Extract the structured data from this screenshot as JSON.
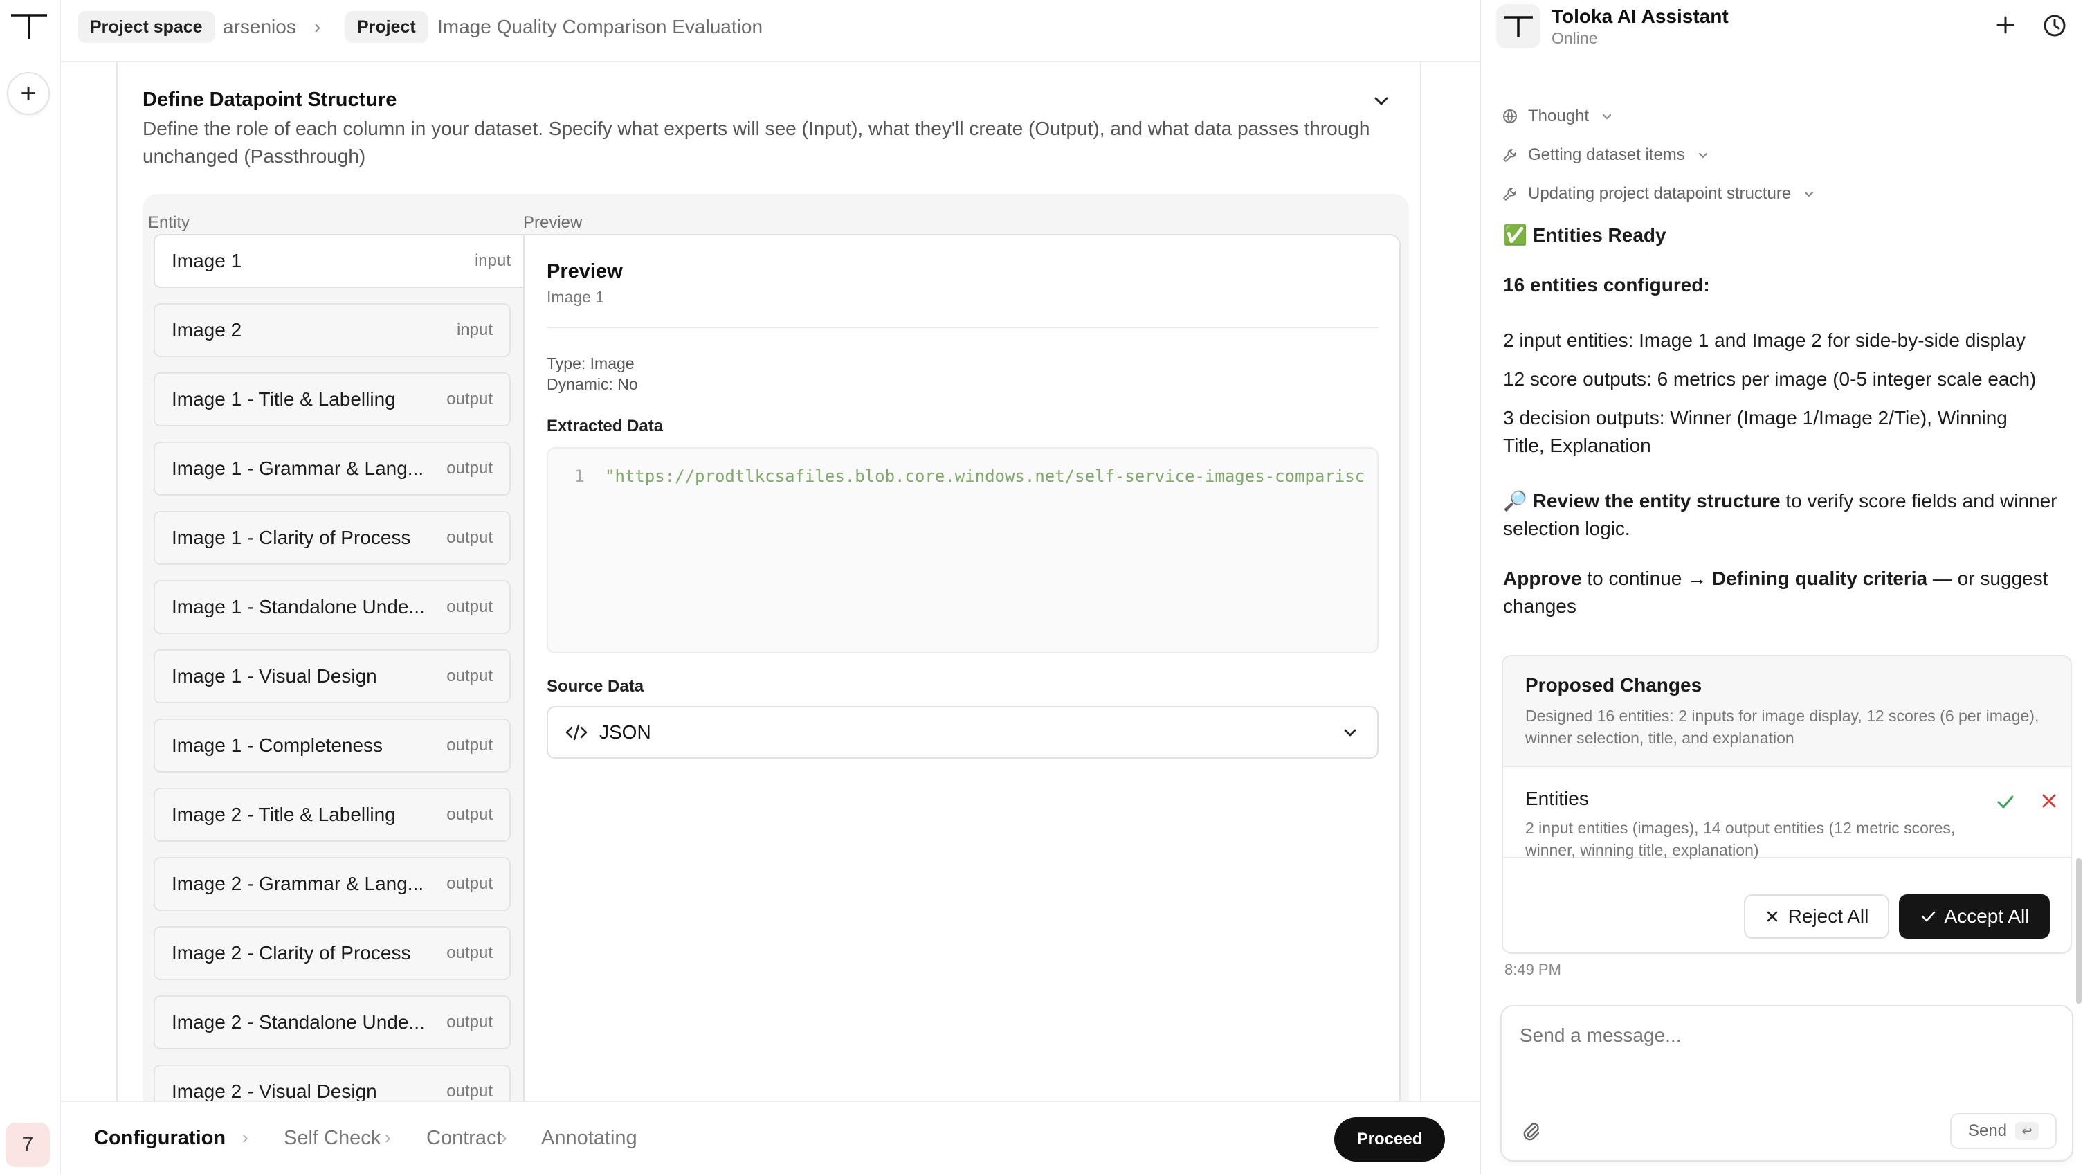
{
  "breadcrumb": {
    "space_chip": "Project space",
    "space_name": "arsenios",
    "separator": "›",
    "project_chip": "Project",
    "project_name": "Image Quality Comparison Evaluation"
  },
  "rail": {
    "user_initial": "7"
  },
  "section": {
    "title": "Define Datapoint Structure",
    "description": "Define the role of each column in your dataset. Specify what experts will see (Input), what they'll create (Output), and what data passes through unchanged (Passthrough)"
  },
  "table": {
    "col_entity": "Entity",
    "col_preview": "Preview",
    "entities": [
      {
        "name": "Image 1",
        "role": "input"
      },
      {
        "name": "Image 2",
        "role": "input"
      },
      {
        "name": "Image 1 - Title & Labelling",
        "role": "output"
      },
      {
        "name": "Image 1 - Grammar & Lang...",
        "role": "output"
      },
      {
        "name": "Image 1 - Clarity of Process",
        "role": "output"
      },
      {
        "name": "Image 1 - Standalone Unde...",
        "role": "output"
      },
      {
        "name": "Image 1 - Visual Design",
        "role": "output"
      },
      {
        "name": "Image 1 - Completeness",
        "role": "output"
      },
      {
        "name": "Image 2 - Title & Labelling",
        "role": "output"
      },
      {
        "name": "Image 2 - Grammar & Lang...",
        "role": "output"
      },
      {
        "name": "Image 2 - Clarity of Process",
        "role": "output"
      },
      {
        "name": "Image 2 - Standalone Unde...",
        "role": "output"
      },
      {
        "name": "Image 2 - Visual Design",
        "role": "output"
      }
    ]
  },
  "preview": {
    "title": "Preview",
    "subtitle": "Image 1",
    "type_label": "Type:",
    "type_value": "Image",
    "dynamic_label": "Dynamic:",
    "dynamic_value": "No",
    "extracted_label": "Extracted Data",
    "code_line_no": "1",
    "code_text": "\"https://prodtlkcsafiles.blob.core.windows.net/self-service-images-comparisc",
    "source_label": "Source Data",
    "source_value": "JSON"
  },
  "steps": {
    "items": [
      "Configuration",
      "Self Check",
      "Contract",
      "Annotating"
    ],
    "separator": "›",
    "proceed": "Proceed"
  },
  "assistant": {
    "name": "Toloka AI Assistant",
    "status": "Online",
    "tools": [
      "Thought",
      "Getting dataset items",
      "Updating project datapoint structure"
    ],
    "ready": "✅ Entities Ready",
    "count_line": "16 entities configured:",
    "lines": [
      "2 input entities: Image 1 and Image 2 for side-by-side display",
      "12 score outputs: 6 metrics per image (0-5 integer scale each)",
      "3 decision outputs: Winner (Image 1/Image 2/Tie), Winning Title, Explanation"
    ],
    "review_prefix": "🔎",
    "review_bold": "Review the entity structure",
    "review_rest": " to verify score fields and winner selection logic.",
    "approve_bold": "Approve",
    "approve_mid": " to continue → ",
    "approve_bold2": "Defining quality criteria",
    "approve_rest": " — or suggest changes",
    "changes_title": "Proposed Changes",
    "changes_desc": "Designed 16 entities: 2 inputs for image display, 12 scores (6 per image), winner selection, title, and explanation",
    "entities_title": "Entities",
    "entities_desc": "2 input entities (images), 14 output entities (12 metric scores, winner, winning title, explanation)",
    "reject_all": "Reject All",
    "accept_all": "Accept All",
    "time": "8:49 PM",
    "composer_placeholder": "Send a message...",
    "send": "Send",
    "enter_glyph": "↩"
  }
}
